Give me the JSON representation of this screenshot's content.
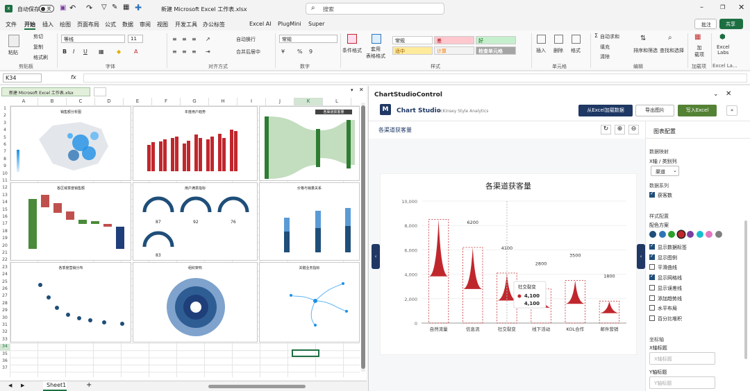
{
  "titlebar": {
    "autosave": "自动保存",
    "toggle": "关",
    "doc_title": "新建 Microsoft Excel 工作表.xlsx",
    "search_placeholder": "搜索"
  },
  "menu": [
    "文件",
    "开始",
    "插入",
    "绘图",
    "页面布局",
    "公式",
    "数据",
    "审阅",
    "视图",
    "开发工具",
    "办公标签",
    "Excel AI",
    "PlugMini",
    "Super"
  ],
  "menu_right": {
    "comment": "批注",
    "share": "共享"
  },
  "ribbon": {
    "paste": "粘贴",
    "cut": "剪切",
    "copy": "复制",
    "format_painter": "格式刷",
    "font_name": "等线",
    "font_size": "11",
    "wrap": "自动换行",
    "merge": "合并后居中",
    "number_format": "常规",
    "percent": "%",
    "comma": "9",
    "cond_format": "条件格式",
    "table_format": "套用\n表格格式",
    "styles": {
      "normal": "常规",
      "bad": "差",
      "good": "好",
      "neutral": "适中",
      "calc": "计算",
      "check": "检查单元格"
    },
    "insert": "插入",
    "delete": "删除",
    "format": "格式",
    "autosum": "自动求和",
    "fill": "填充",
    "clear": "清除",
    "sort": "排序和筛选",
    "find": "查找和选择",
    "addins": "加\n载项",
    "excel_labs": "Excel\nLabs",
    "groups": {
      "clipboard": "剪贴板",
      "font": "字体",
      "align": "对齐方式",
      "number": "数字",
      "style": "样式",
      "cells": "单元格",
      "edit": "编辑",
      "addin": "加载项",
      "labs": "Excel La..."
    }
  },
  "formula": {
    "namebox": "K34"
  },
  "workbook": {
    "tab": "新建 Microsoft Excel 工作表.xlsx",
    "sheet": "Sheet1"
  },
  "columns": [
    "A",
    "B",
    "C",
    "D",
    "E",
    "F",
    "G",
    "H",
    "I",
    "J",
    "K",
    "L"
  ],
  "rows": [
    "1",
    "2",
    "3",
    "4",
    "5",
    "6",
    "7",
    "8",
    "9",
    "10",
    "11",
    "12",
    "13",
    "14",
    "15",
    "16",
    "17",
    "18",
    "19",
    "20",
    "21",
    "22",
    "23",
    "24",
    "25",
    "26",
    "27",
    "28",
    "29",
    "30",
    "31",
    "32",
    "33",
    "34",
    "35",
    "36",
    "37"
  ],
  "thumbs": [
    "销售额分析图",
    "年度用户趋势",
    "各渠道获客量",
    "各区域季度销售额",
    "用户满意指标",
    "价格与销量关系",
    "各季度营销分布",
    "组织架构",
    "关键业务指标"
  ],
  "panel": {
    "title": "ChartStudioControl",
    "brand": "Chart Studio",
    "brand_sub": "McKinsey Style Analytics",
    "logo": "M",
    "btn_load": "从Excel加载数据",
    "btn_export": "导出图片",
    "btn_write": "写入Excel",
    "chart_label": "各渠道获客量",
    "settings_title": "图表配置",
    "data_map": "数据映射",
    "x_axis": "X轴 / 类别列",
    "x_select": "渠道",
    "series_label": "数据系列",
    "series_item": "获客数",
    "style_config": "样式配置",
    "palette_label": "配色方案",
    "options": [
      {
        "label": "显示数据标签",
        "on": true
      },
      {
        "label": "显示图例",
        "on": true
      },
      {
        "label": "平滑曲线",
        "on": false
      },
      {
        "label": "显示网格线",
        "on": true
      },
      {
        "label": "显示误差线",
        "on": false
      },
      {
        "label": "添加趋势线",
        "on": false
      },
      {
        "label": "水平布局",
        "on": false
      },
      {
        "label": "百分比堆积",
        "on": false
      }
    ],
    "axis_title": "坐标轴",
    "x_title_label": "X轴标题",
    "x_title_ph": "X轴标题",
    "y_title_label": "Y轴标题",
    "y_title_ph": "Y轴标题",
    "palette": [
      "#1f4e79",
      "#2e75b6",
      "#2ca02c",
      "#c0272d",
      "#7b3fa0",
      "#17becf",
      "#e377c2",
      "#7f7f7f"
    ]
  },
  "chart_data": {
    "type": "bar",
    "title": "各渠道获客量",
    "categories": [
      "自然流量",
      "信息流",
      "社交裂变",
      "线下活动",
      "KOL合作",
      "邮件营销"
    ],
    "values": [
      8500,
      6200,
      4100,
      2800,
      3500,
      1800
    ],
    "ylim": [
      0,
      10000
    ],
    "yticks": [
      "0",
      "2,000",
      "4,000",
      "6,000",
      "8,000",
      "10,000"
    ],
    "data_labels": [
      "",
      "6200",
      "4100",
      "2800",
      "3500",
      "1800"
    ],
    "tooltip": {
      "category": "社交裂变",
      "value1": "4,100",
      "value2": "4,100"
    },
    "bar_color": "#c0272d",
    "grid": true
  }
}
